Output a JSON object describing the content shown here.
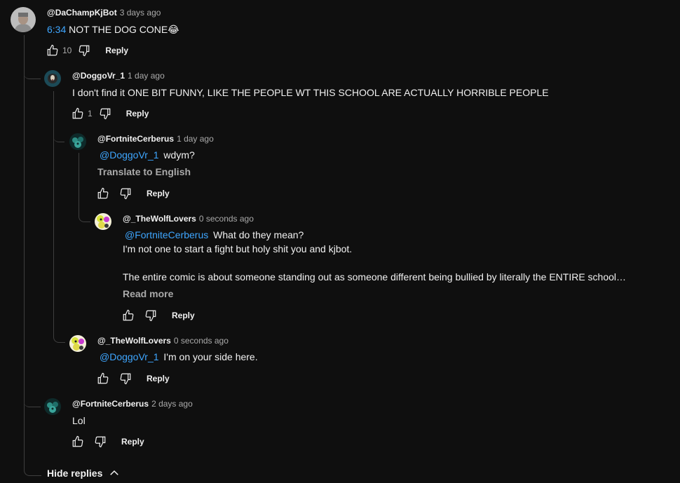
{
  "comments": [
    {
      "author": "@DaChampKjBot",
      "time": "3 days ago",
      "timestamp_link": "6:34",
      "text": " NOT THE DOG CONE",
      "emoji": "😂",
      "likes": "10",
      "reply": "Reply"
    },
    {
      "author": "@DoggoVr_1",
      "time": "1 day ago",
      "text": "I don't find it ONE BIT FUNNY, LIKE THE PEOPLE WT THIS SCHOOL ARE ACTUALLY HORRIBLE PEOPLE",
      "likes": "1",
      "reply": "Reply"
    },
    {
      "author": "@FortniteCerberus",
      "time": "1 day ago",
      "mention": "@DoggoVr_1",
      "text": " wdym?",
      "translate": "Translate to English",
      "reply": "Reply"
    },
    {
      "author": "@_TheWolfLovers",
      "time": "0 seconds ago",
      "mention": "@FortniteCerberus",
      "text": " What do they mean?",
      "line2": "I'm not one to start a fight but holy shit you and kjbot.",
      "line3": "The entire comic is about someone standing out as someone different being bullied by literally the ENTIRE school…",
      "read_more": "Read more",
      "reply": "Reply"
    },
    {
      "author": "@_TheWolfLovers",
      "time": "0 seconds ago",
      "mention": "@DoggoVr_1",
      "text": " I'm on your side here.",
      "reply": "Reply"
    },
    {
      "author": "@FortniteCerberus",
      "time": "2 days ago",
      "text": "Lol",
      "reply": "Reply"
    }
  ],
  "hide_replies": "Hide replies",
  "colors": {
    "background": "#0f0f0f",
    "link": "#3ea6ff",
    "muted": "#aaaaaa",
    "thread_line": "#3f3f3f"
  },
  "icons": [
    "like-icon",
    "dislike-icon",
    "chevron-up-icon"
  ]
}
